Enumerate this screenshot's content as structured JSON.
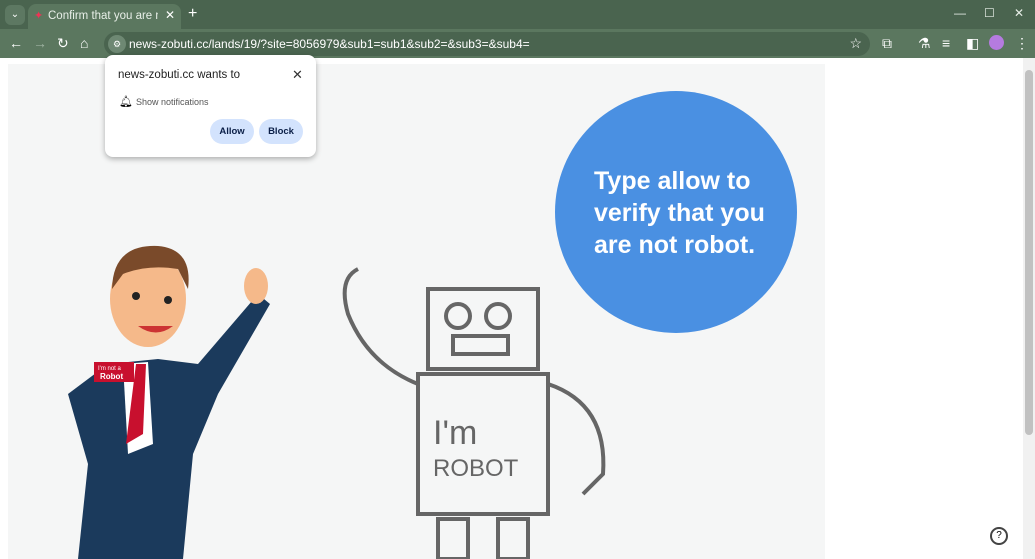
{
  "browser": {
    "tab_title": "Confirm that you are not a robot",
    "url": "news-zobuti.cc/lands/19/?site=8056979&sub1=sub1&sub2=&sub3=&sub4="
  },
  "popup": {
    "title": "news-zobuti.cc wants to",
    "permission": "Show notifications",
    "allow": "Allow",
    "block": "Block"
  },
  "page": {
    "bubble_text": "Type allow to verify that you are not robot.",
    "badge_line1": "I'm not a",
    "badge_line2": "Robot",
    "robot_line1": "I'm",
    "robot_line2": "ROBOT",
    "bubble_color": "#4a90e2"
  }
}
